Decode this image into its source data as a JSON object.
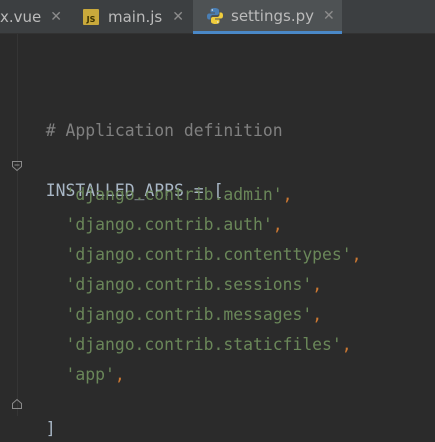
{
  "tabs": [
    {
      "label": "x.vue",
      "icon": "vue-file-icon",
      "active": false
    },
    {
      "label": "main.js",
      "icon": "js-file-icon",
      "active": false
    },
    {
      "label": "settings.py",
      "icon": "python-file-icon",
      "active": true
    }
  ],
  "tab_close_glyph": "✕",
  "code": {
    "comment": "# Application definition",
    "assign_name": "INSTALLED_APPS",
    "assign_op": " = ",
    "open_bracket": "[",
    "close_bracket": "]",
    "comma": ",",
    "apps": [
      "'django.contrib.admin'",
      "'django.contrib.auth'",
      "'django.contrib.contenttypes'",
      "'django.contrib.sessions'",
      "'django.contrib.messages'",
      "'django.contrib.staticfiles'",
      "'app'"
    ]
  },
  "colors": {
    "background": "#2b2b2b",
    "tabbar": "#3c3f41",
    "active_tab": "#4e5254",
    "active_underline": "#4a88c7",
    "comment": "#808080",
    "identifier": "#a9b7c6",
    "string": "#6a8759",
    "keyword_punct": "#cc7832"
  }
}
